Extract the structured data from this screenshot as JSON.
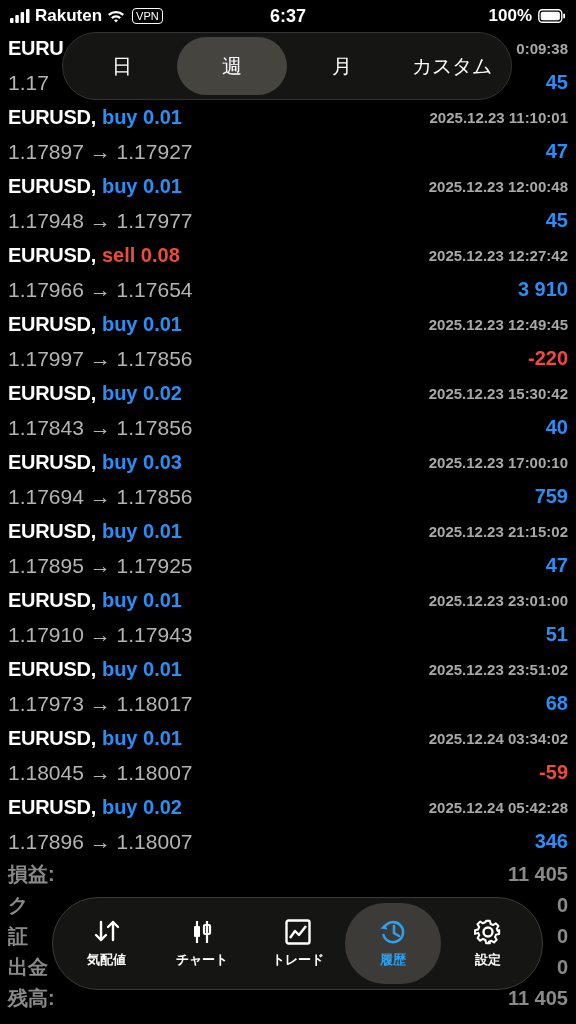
{
  "status_bar": {
    "carrier": "Rakuten",
    "vpn": "VPN",
    "time": "6:37",
    "battery": "100%"
  },
  "period_tabs": [
    {
      "label": "日",
      "selected": false
    },
    {
      "label": "週",
      "selected": true
    },
    {
      "label": "月",
      "selected": false
    },
    {
      "label": "カスタム",
      "selected": false
    }
  ],
  "trades": [
    {
      "symbol": "EURU",
      "time": "0:09:38",
      "prices": "1.17",
      "profit": "45",
      "loss": false
    },
    {
      "symbol": "EURUSD,",
      "kind": "buy",
      "volume": "buy 0.01",
      "time": "2025.12.23 11:10:01",
      "prices": "1.17897 → 1.17927",
      "profit": "47",
      "loss": false
    },
    {
      "symbol": "EURUSD,",
      "kind": "buy",
      "volume": "buy 0.01",
      "time": "2025.12.23 12:00:48",
      "prices": "1.17948 → 1.17977",
      "profit": "45",
      "loss": false
    },
    {
      "symbol": "EURUSD,",
      "kind": "sell",
      "volume": "sell 0.08",
      "time": "2025.12.23 12:27:42",
      "prices": "1.17966 → 1.17654",
      "profit": "3 910",
      "loss": false
    },
    {
      "symbol": "EURUSD,",
      "kind": "buy",
      "volume": "buy 0.01",
      "time": "2025.12.23 12:49:45",
      "prices": "1.17997 → 1.17856",
      "profit": "-220",
      "loss": true
    },
    {
      "symbol": "EURUSD,",
      "kind": "buy",
      "volume": "buy 0.02",
      "time": "2025.12.23 15:30:42",
      "prices": "1.17843 → 1.17856",
      "profit": "40",
      "loss": false
    },
    {
      "symbol": "EURUSD,",
      "kind": "buy",
      "volume": "buy 0.03",
      "time": "2025.12.23 17:00:10",
      "prices": "1.17694 → 1.17856",
      "profit": "759",
      "loss": false
    },
    {
      "symbol": "EURUSD,",
      "kind": "buy",
      "volume": "buy 0.01",
      "time": "2025.12.23 21:15:02",
      "prices": "1.17895 → 1.17925",
      "profit": "47",
      "loss": false
    },
    {
      "symbol": "EURUSD,",
      "kind": "buy",
      "volume": "buy 0.01",
      "time": "2025.12.23 23:01:00",
      "prices": "1.17910 → 1.17943",
      "profit": "51",
      "loss": false
    },
    {
      "symbol": "EURUSD,",
      "kind": "buy",
      "volume": "buy 0.01",
      "time": "2025.12.23 23:51:02",
      "prices": "1.17973 → 1.18017",
      "profit": "68",
      "loss": false
    },
    {
      "symbol": "EURUSD,",
      "kind": "buy",
      "volume": "buy 0.01",
      "time": "2025.12.24 03:34:02",
      "prices": "1.18045 → 1.18007",
      "profit": "-59",
      "loss": true
    },
    {
      "symbol": "EURUSD,",
      "kind": "buy",
      "volume": "buy 0.02",
      "time": "2025.12.24 05:42:28",
      "prices": "1.17896 → 1.18007",
      "profit": "346",
      "loss": false
    }
  ],
  "summary": [
    {
      "label": "損益:",
      "value": "11 405"
    },
    {
      "label": "ク",
      "value": "0"
    },
    {
      "label": "証",
      "value": "0"
    },
    {
      "label": "出金",
      "value": "0"
    },
    {
      "label": "残高:",
      "value": "11 405"
    }
  ],
  "nav": [
    {
      "kind": "arrows",
      "label": "気配値",
      "selected": false
    },
    {
      "kind": "candles",
      "label": "チャート",
      "selected": false
    },
    {
      "kind": "chart",
      "label": "トレード",
      "selected": false
    },
    {
      "kind": "history",
      "label": "履歴",
      "selected": true
    },
    {
      "kind": "gear",
      "label": "設定",
      "selected": false
    }
  ]
}
